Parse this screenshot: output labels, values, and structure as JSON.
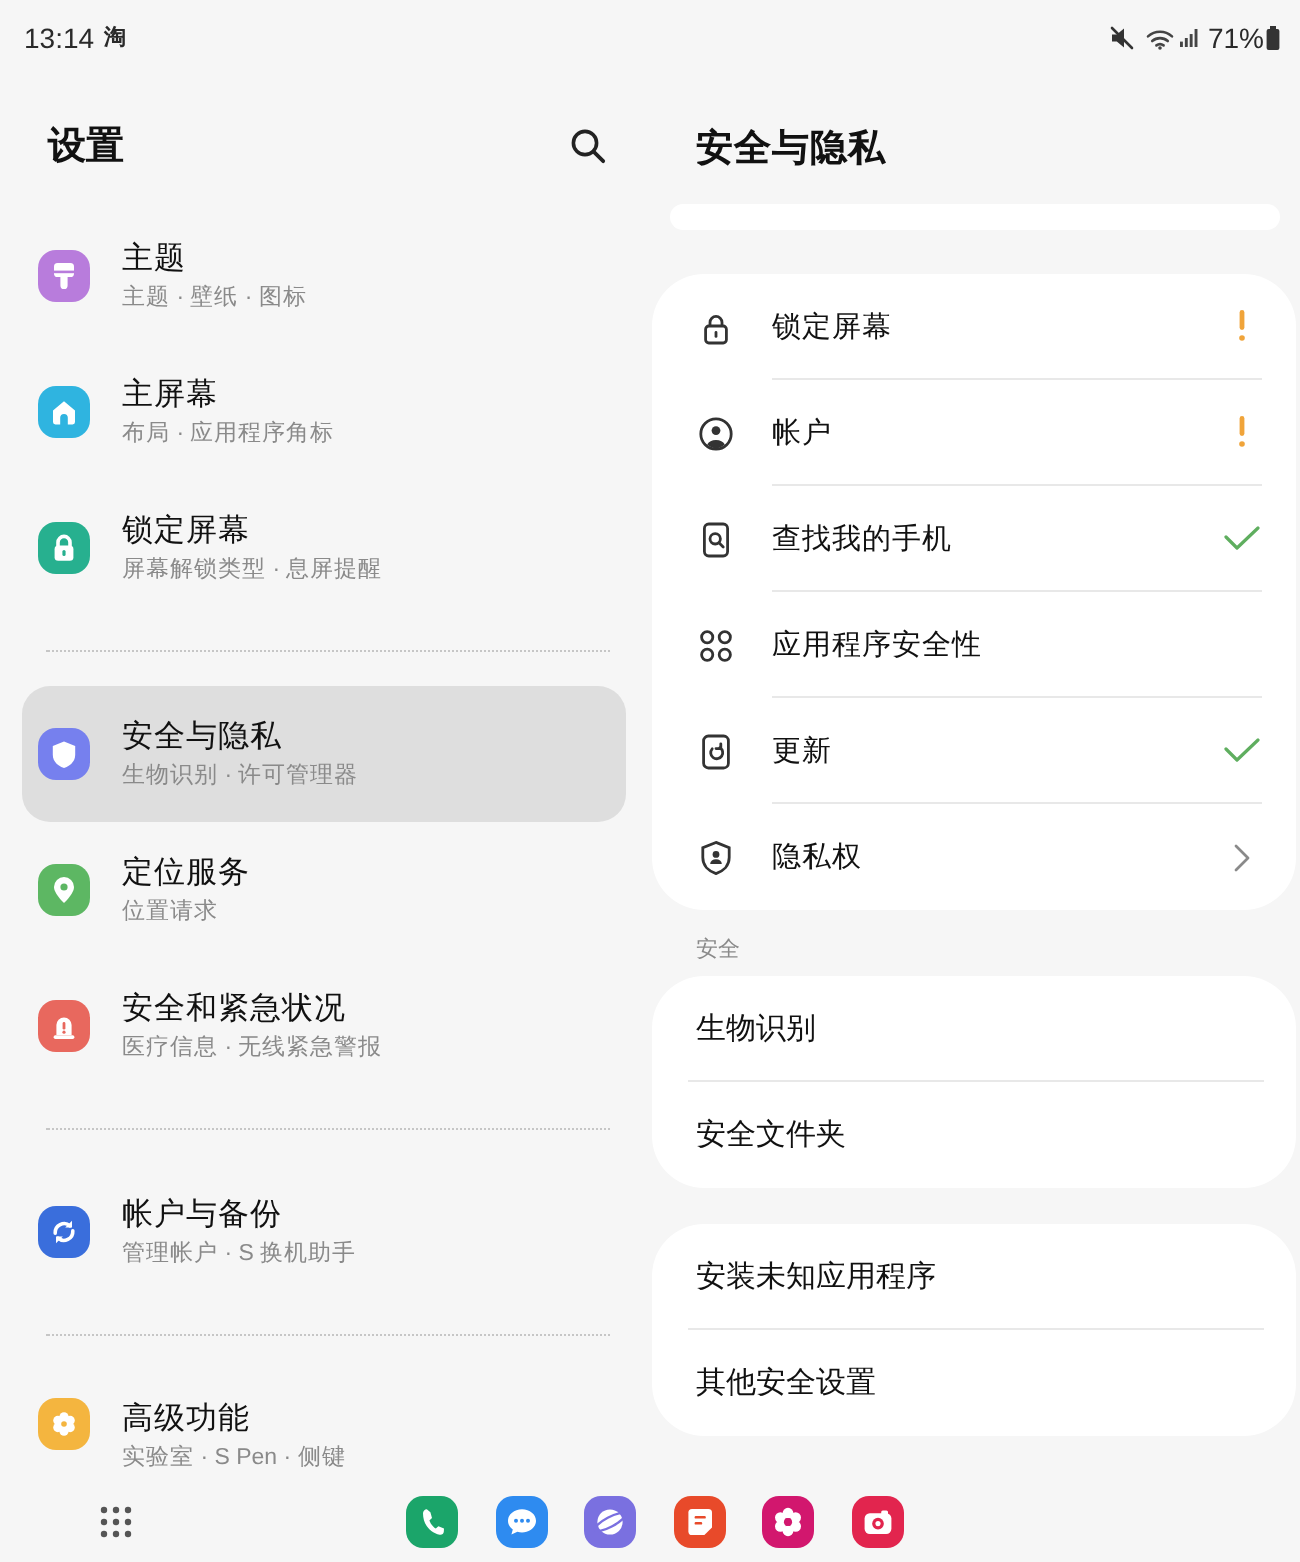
{
  "status_bar": {
    "time": "13:14",
    "notification": "淘",
    "battery": "71%"
  },
  "settings": {
    "title": "设置",
    "groups": [
      {
        "items": [
          {
            "title": "主题",
            "subtitle": "主题 · 壁纸 · 图标",
            "color": "#b87cdc",
            "selected": false
          },
          {
            "title": "主屏幕",
            "subtitle": "布局 · 应用程序角标",
            "color": "#2fb4e0",
            "selected": false
          },
          {
            "title": "锁定屏幕",
            "subtitle": "屏幕解锁类型 · 息屏提醒",
            "color": "#27b08f",
            "selected": false
          }
        ]
      },
      {
        "items": [
          {
            "title": "安全与隐私",
            "subtitle": "生物识别 · 许可管理器",
            "color": "#7680ee",
            "selected": true
          },
          {
            "title": "定位服务",
            "subtitle": "位置请求",
            "color": "#5db763",
            "selected": false
          },
          {
            "title": "安全和紧急状况",
            "subtitle": "医疗信息 · 无线紧急警报",
            "color": "#e8685e",
            "selected": false
          }
        ]
      },
      {
        "items": [
          {
            "title": "帐户与备份",
            "subtitle": "管理帐户 · S 换机助手",
            "color": "#3a6edc",
            "selected": false
          }
        ]
      },
      {
        "items": [
          {
            "title": "高级功能",
            "subtitle": "实验室 · S Pen · 侧键",
            "color": "#f4b53f",
            "selected": false
          }
        ]
      }
    ]
  },
  "detail": {
    "title": "安全与隐私",
    "cards": [
      {
        "kind": "icon_list",
        "rows": [
          {
            "label": "锁定屏幕",
            "kind": "warning"
          },
          {
            "label": "帐户",
            "kind": "warning"
          },
          {
            "label": "查找我的手机",
            "kind": "ok"
          },
          {
            "label": "应用程序安全性",
            "kind": "plain"
          },
          {
            "label": "更新",
            "kind": "ok"
          },
          {
            "label": "隐私权",
            "kind": "link"
          }
        ]
      },
      {
        "kind": "text_list",
        "header": "安全",
        "rows": [
          {
            "label": "生物识别"
          },
          {
            "label": "安全文件夹"
          }
        ]
      },
      {
        "kind": "text_list",
        "rows": [
          {
            "label": "安装未知应用程序"
          },
          {
            "label": "其他安全设置"
          }
        ]
      }
    ]
  }
}
